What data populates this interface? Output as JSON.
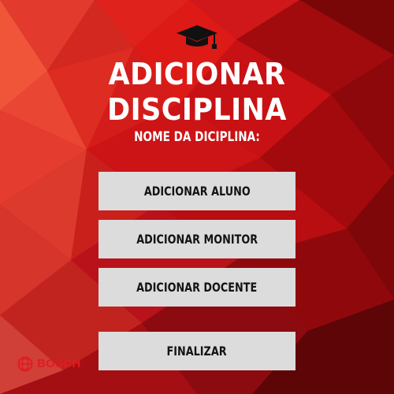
{
  "app": {
    "title_line1": "ADICIONAR",
    "title_line2": "DISCIPLINA",
    "subtitle": "NOME DA DICIPLINA:",
    "header_icon": "graduation-cap-icon"
  },
  "actions": {
    "add_student": "ADICIONAR ALUNO",
    "add_monitor": "ADICIONAR MONITOR",
    "add_teacher": "ADICIONAR DOCENTE",
    "finish": "FINALIZAR"
  },
  "branding": {
    "logo_text": "BOSCH",
    "logo_icon": "bosch-armature-icon"
  },
  "colors": {
    "background": "#c00d10",
    "button": "#dcdcdc",
    "button_text": "#141414",
    "brand_red": "#e01b21",
    "text": "#ffffff"
  }
}
